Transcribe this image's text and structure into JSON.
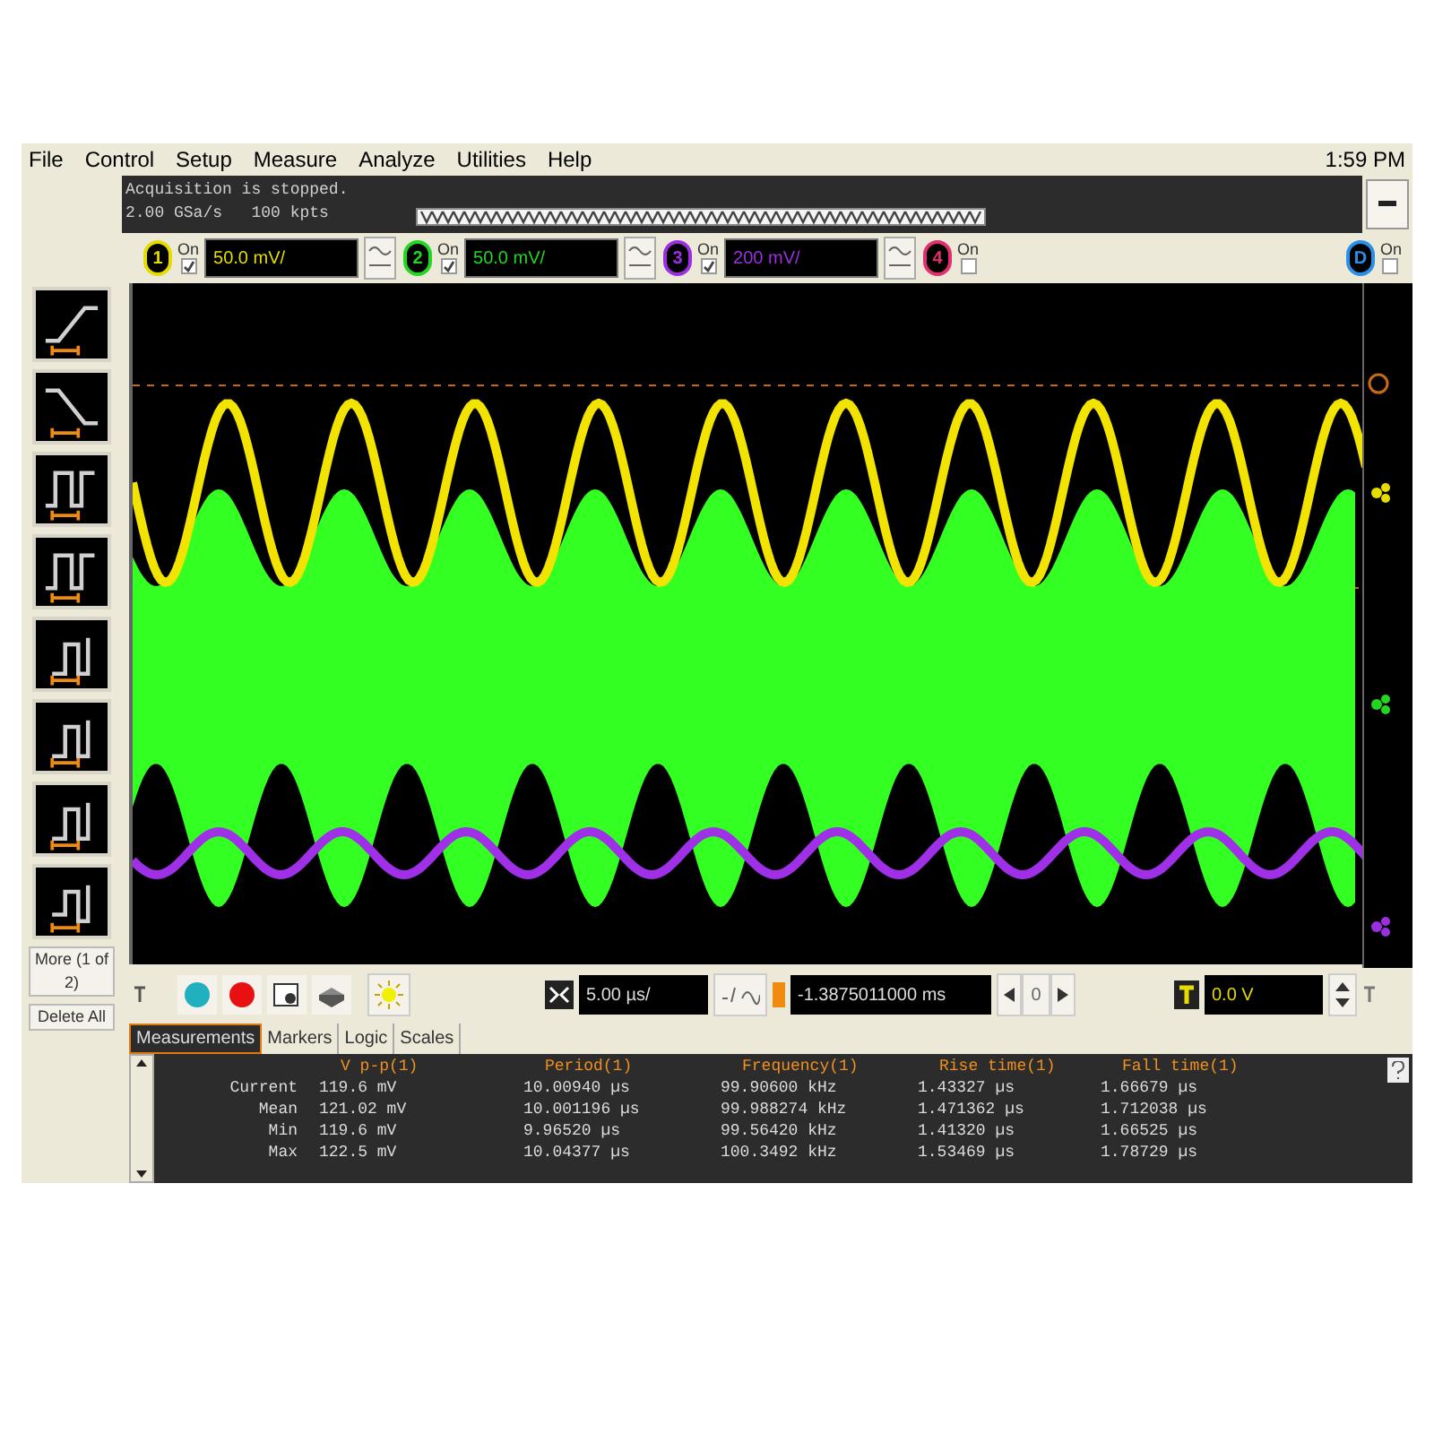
{
  "menu": [
    "File",
    "Control",
    "Setup",
    "Measure",
    "Analyze",
    "Utilities",
    "Help"
  ],
  "clock": "1:59 PM",
  "status": [
    "Acquisition is stopped.",
    "2.00 GSa/s   100 kpts"
  ],
  "channels": [
    {
      "label": "1",
      "on": true,
      "on_label": "On",
      "scale": "50.0 mV/",
      "color": "#e6dc00"
    },
    {
      "label": "2",
      "on": true,
      "on_label": "On",
      "scale": "50.0 mV/",
      "color": "#22d622"
    },
    {
      "label": "3",
      "on": true,
      "on_label": "On",
      "scale": "200 mV/",
      "color": "#9b30e0"
    },
    {
      "label": "4",
      "on": false,
      "on_label": "On",
      "color": "#e0306e"
    },
    {
      "label": "D",
      "on": false,
      "on_label": "On",
      "color": "#2a90e8"
    }
  ],
  "side_buttons": [
    "More (1 of 2)",
    "Delete All"
  ],
  "timebase": "5.00 µs/",
  "delay": "-1.3875011000 ms",
  "delay_step": "0",
  "trigger_level": "0.0 V",
  "tabs": [
    {
      "label": "Measurements",
      "selected": true
    },
    {
      "label": "Markers",
      "selected": false
    },
    {
      "label": "Logic",
      "selected": false
    },
    {
      "label": "Scales",
      "selected": false
    }
  ],
  "measurements": {
    "columns": [
      "V p-p(1)",
      "Period(1)",
      "Frequency(1)",
      "Rise time(1)",
      "Fall time(1)"
    ],
    "rows": [
      {
        "label": "Current",
        "values": [
          "119.6 mV",
          "10.00940 µs",
          "99.90600 kHz",
          "1.43327 µs",
          "1.66679 µs"
        ]
      },
      {
        "label": "Mean",
        "values": [
          "121.02 mV",
          "10.001196 µs",
          "99.988274 kHz",
          "1.471362 µs",
          "1.712038 µs"
        ]
      },
      {
        "label": "Min",
        "values": [
          "119.6 mV",
          "9.96520 µs",
          "99.56420 kHz",
          "1.41320 µs",
          "1.66525 µs"
        ]
      },
      {
        "label": "Max",
        "values": [
          "122.5 mV",
          "10.04377 µs",
          "100.3492 kHz",
          "1.53469 µs",
          "1.78729 µs"
        ]
      }
    ]
  }
}
